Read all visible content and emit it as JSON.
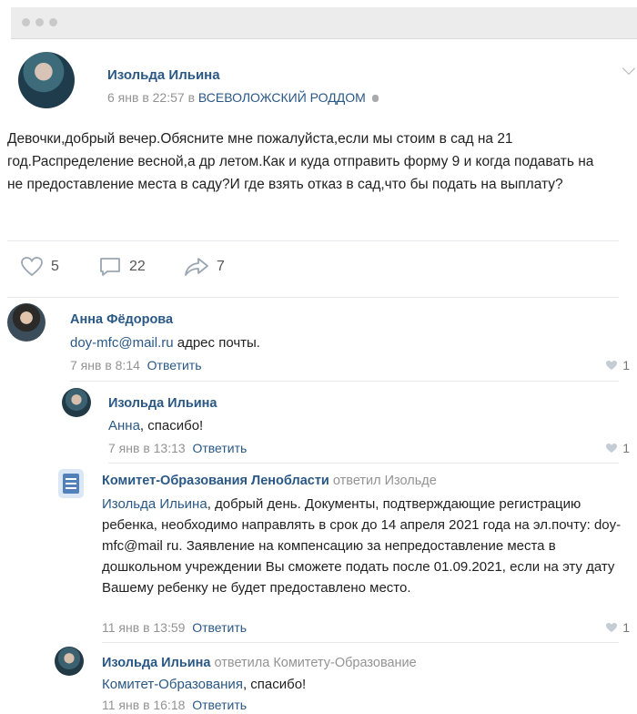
{
  "post": {
    "author": "Изольда Ильина",
    "date": "6 янв в 22:57",
    "in_word": "в",
    "group": "ВСЕВОЛОЖСКИЙ РОДДОМ",
    "text": "Девочки,добрый вечер.Обясните мне пожалуйста,если мы стоим в сад на 21 год.Распределение весной,а др летом.Как и куда отправить форму 9 и когда подавать на не предоставление места в саду?И где взять отказ в сад,что бы подать на выплату?",
    "likes": "5",
    "comments": "22",
    "shares": "7"
  },
  "comments": [
    {
      "author": "Анна Фёдорова",
      "text_link": "doy-mfc@mail.ru",
      "text_rest": " адрес почты.",
      "date": "7 янв в 8:14",
      "reply": "Ответить",
      "likes": "1"
    },
    {
      "author": "Изольда Ильина",
      "text_link": "Анна",
      "text_rest": ", спасибо!",
      "date": "7 янв в 13:13",
      "reply": "Ответить",
      "likes": "1"
    },
    {
      "author": "Комитет-Образования Ленобласти",
      "answered": "ответил Изольде",
      "text_link": "Изольда Ильина",
      "text_rest": ", добрый день. Документы, подтверждающие регистрацию ребенка, необходимо направлять в срок до 14 апреля 2021 года на эл.почту: doy-mfc@mail ru. Заявление на компенсацию за непредоставление места в дошкольном учреждении Вы сможете подать после 01.09.2021, если на эту дату Вашему ребенку не будет предоставлено место.",
      "date": "11 янв в 13:59",
      "reply": "Ответить",
      "likes": "1"
    },
    {
      "author": "Изольда Ильина",
      "answered": "ответила Комитету-Образование",
      "text_link": "Комитет-Образования",
      "text_rest": ", спасибо!",
      "date": "11 янв в 16:18",
      "reply": "Ответить"
    }
  ]
}
